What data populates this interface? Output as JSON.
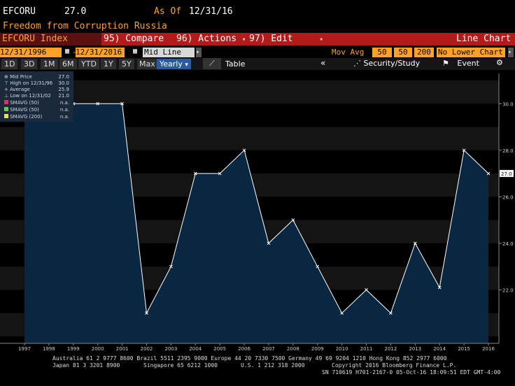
{
  "header": {
    "ticker": "EFCORU",
    "value": "27.0",
    "asof_label": "As Of",
    "asof_date": "12/31/16",
    "subtitle": "Freedom from Corruption Russia"
  },
  "toolbar": {
    "security": "EFCORU Index",
    "compare": "95) Compare",
    "actions": "96) Actions",
    "edit": "97) Edit",
    "chart_type": "Line Chart"
  },
  "range_bar": {
    "start_date": "12/31/1996",
    "end_date": "12/31/2016",
    "line_mode": "Mid Line",
    "mov_avg_label": "Mov Avg",
    "mov_avg_1": "50",
    "mov_avg_2": "50",
    "mov_avg_3": "200",
    "lower_chart": "No Lower Chart"
  },
  "period_bar": {
    "periods": [
      "1D",
      "3D",
      "1M",
      "6M",
      "YTD",
      "1Y",
      "5Y",
      "Max"
    ],
    "frequency": "Yearly",
    "table": "Table",
    "security_study": "Security/Study",
    "event": "Event"
  },
  "legend": [
    {
      "label": "Mid Price",
      "value": "27.0"
    },
    {
      "label": "High on 12/31/96",
      "value": "30.0"
    },
    {
      "label": "Average",
      "value": "25.9"
    },
    {
      "label": "Low on 12/31/02",
      "value": "21.0"
    },
    {
      "label": "SMAVG (50)",
      "value": "n.a."
    },
    {
      "label": "SMAVG (50)",
      "value": "n.a."
    },
    {
      "label": "SMAVG (200)",
      "value": "n.a."
    }
  ],
  "colors": {
    "line": "#ffffff",
    "fill": "#0a2742",
    "brand_red": "#b31b1b",
    "amber": "#ffa028",
    "smavg1": "#e0306a",
    "smavg2": "#6ac850",
    "smavg3": "#f0e060"
  },
  "chart_data": {
    "type": "area",
    "x": [
      "1997",
      "1998",
      "1999",
      "2000",
      "2001",
      "2002",
      "2003",
      "2004",
      "2005",
      "2006",
      "2007",
      "2008",
      "2009",
      "2010",
      "2011",
      "2012",
      "2013",
      "2014",
      "2015",
      "2016"
    ],
    "values": [
      30,
      30,
      30,
      30,
      30,
      21,
      23,
      27,
      27,
      28,
      24,
      25,
      23,
      21,
      22,
      21,
      24,
      22.1,
      28,
      27
    ],
    "yticks": [
      "22.0",
      "24.0",
      "26.0",
      "28.0",
      "30.0"
    ],
    "ylim": [
      19.7,
      31.3
    ],
    "last_value_label": "27.0",
    "grid": false
  },
  "footer": {
    "line1": "Australia 61 2 9777 8600 Brazil 5511 2395 9000 Europe 44 20 7330 7500 Germany 49 69 9204 1210 Hong Kong 852 2977 6000",
    "line2a": "Japan 81 3 3201 8900",
    "line2b": "Singapore 65 6212 1000",
    "line2c": "U.S. 1 212 318 2000",
    "line2d": "Copyright 2016 Bloomberg Finance L.P.",
    "line3": "SN 710619 H701-2167-0 05-Oct-16 18:09:51 EDT  GMT-4:00"
  }
}
